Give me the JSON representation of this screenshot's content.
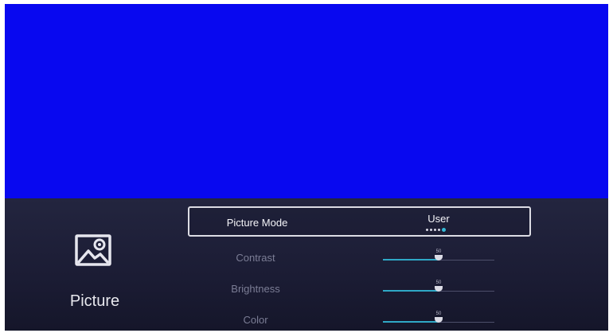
{
  "category": {
    "label": "Picture",
    "icon": "picture-icon"
  },
  "colors": {
    "video_background": "#0808f0",
    "accent": "#2fa8c6",
    "panel": "#1e2038"
  },
  "settings": {
    "picture_mode": {
      "label": "Picture Mode",
      "value": "User",
      "option_count": 5,
      "selected_option_index": 4
    },
    "contrast": {
      "label": "Contrast",
      "value": "50",
      "level_percent": 50
    },
    "brightness": {
      "label": "Brightness",
      "value": "50",
      "level_percent": 50
    },
    "color": {
      "label": "Color",
      "value": "50",
      "level_percent": 50
    }
  }
}
